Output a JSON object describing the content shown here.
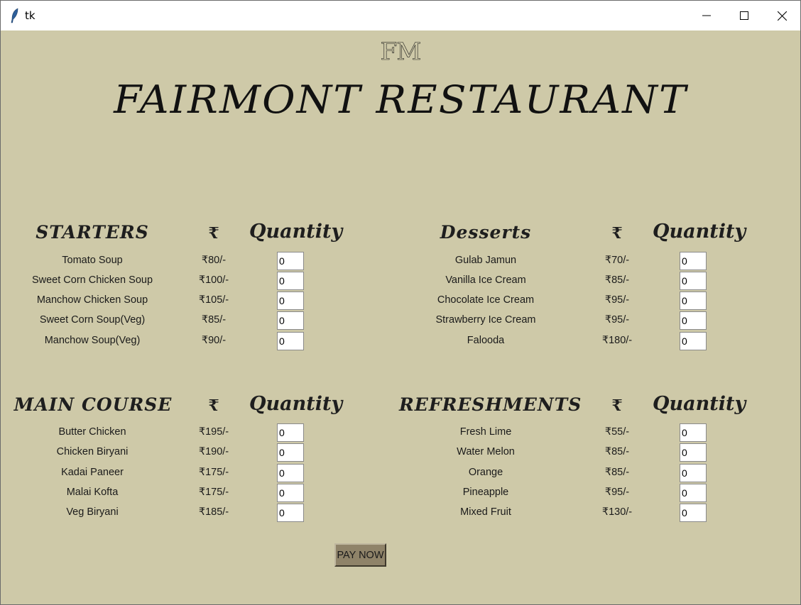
{
  "window": {
    "title": "tk"
  },
  "logo": "FM",
  "restaurant_name": "FAIRMONT RESTAURANT",
  "currency_symbol": "₹",
  "quantity_header": "Quantity",
  "sections": {
    "starters": {
      "title": "STARTERS",
      "items": [
        {
          "name": "Tomato Soup",
          "price": "₹80/-",
          "qty": "0"
        },
        {
          "name": "Sweet Corn Chicken Soup",
          "price": "₹100/-",
          "qty": "0"
        },
        {
          "name": "Manchow Chicken Soup",
          "price": "₹105/-",
          "qty": "0"
        },
        {
          "name": "Sweet Corn Soup(Veg)",
          "price": "₹85/-",
          "qty": "0"
        },
        {
          "name": "Manchow Soup(Veg)",
          "price": "₹90/-",
          "qty": "0"
        }
      ]
    },
    "desserts": {
      "title": "Desserts",
      "items": [
        {
          "name": "Gulab Jamun",
          "price": "₹70/-",
          "qty": "0"
        },
        {
          "name": "Vanilla Ice Cream",
          "price": "₹85/-",
          "qty": "0"
        },
        {
          "name": "Chocolate Ice Cream",
          "price": "₹95/-",
          "qty": "0"
        },
        {
          "name": "Strawberry Ice Cream",
          "price": "₹95/-",
          "qty": "0"
        },
        {
          "name": "Falooda",
          "price": "₹180/-",
          "qty": "0"
        }
      ]
    },
    "main_course": {
      "title": "MAIN COURSE",
      "items": [
        {
          "name": "Butter Chicken",
          "price": "₹195/-",
          "qty": "0"
        },
        {
          "name": "Chicken Biryani",
          "price": "₹190/-",
          "qty": "0"
        },
        {
          "name": "Kadai Paneer",
          "price": "₹175/-",
          "qty": "0"
        },
        {
          "name": "Malai Kofta",
          "price": "₹175/-",
          "qty": "0"
        },
        {
          "name": "Veg Biryani",
          "price": "₹185/-",
          "qty": "0"
        }
      ]
    },
    "refreshments": {
      "title": "REFRESHMENTS",
      "items": [
        {
          "name": "Fresh Lime",
          "price": "₹55/-",
          "qty": "0"
        },
        {
          "name": "Water Melon",
          "price": "₹85/-",
          "qty": "0"
        },
        {
          "name": "Orange",
          "price": "₹85/-",
          "qty": "0"
        },
        {
          "name": "Pineapple",
          "price": "₹95/-",
          "qty": "0"
        },
        {
          "name": "Mixed Fruit",
          "price": "₹130/-",
          "qty": "0"
        }
      ]
    }
  },
  "pay_button": "PAY NOW"
}
